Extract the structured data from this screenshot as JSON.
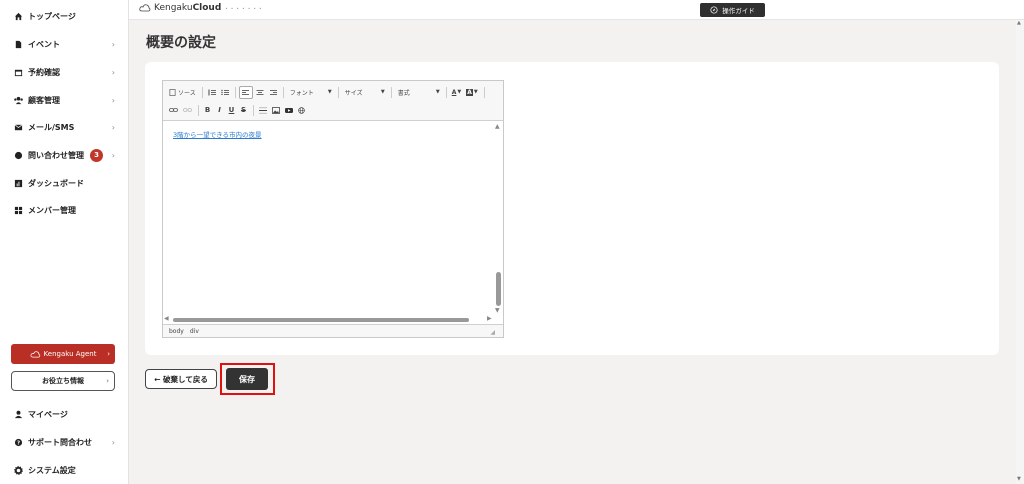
{
  "sidebar": {
    "items": [
      {
        "label": "トップページ",
        "icon": "home-icon",
        "chevron": ""
      },
      {
        "label": "イベント",
        "icon": "document-icon",
        "chevron": "›"
      },
      {
        "label": "予約確認",
        "icon": "calendar-icon",
        "chevron": "›"
      },
      {
        "label": "顧客管理",
        "icon": "users-icon",
        "chevron": "›"
      },
      {
        "label": "メール/SMS",
        "icon": "mail-icon",
        "chevron": "›"
      },
      {
        "label": "問い合わせ管理",
        "icon": "chat-icon",
        "chevron": "›",
        "badge": "3"
      },
      {
        "label": "ダッシュボード",
        "icon": "chart-icon",
        "chevron": ""
      },
      {
        "label": "メンバー管理",
        "icon": "grid-icon",
        "chevron": ""
      }
    ],
    "agent_button": "Kengaku Agent",
    "help_button": "お役立ち情報",
    "bottom_items": [
      {
        "label": "マイページ",
        "icon": "person-icon",
        "chevron": ""
      },
      {
        "label": "サポート問合わせ",
        "icon": "question-icon",
        "chevron": "›"
      },
      {
        "label": "システム設定",
        "icon": "gear-icon",
        "chevron": ""
      }
    ]
  },
  "header": {
    "logo_text": "Kengaku",
    "logo_bold": "Cloud",
    "logo_sub": "• • • • • • •",
    "guide_button": "操作ガイド"
  },
  "main": {
    "title": "概要の設定",
    "editor": {
      "toolbar": {
        "source": "ソース",
        "font": "フォント",
        "size": "サイズ",
        "format": "書式",
        "bold": "B",
        "italic": "I",
        "underline": "U",
        "strike": "S",
        "font_color": "A",
        "bg_color": "A"
      },
      "content_link": "3階から一望できる市内の夜景",
      "status_path": [
        "body",
        "div"
      ]
    },
    "back_button": "← 破棄して戻る",
    "save_button": "保存"
  },
  "colors": {
    "accent_red": "#b92e25",
    "badge_red": "#c0372a",
    "highlight_red": "#e01010",
    "dark_button": "#333333",
    "link_blue": "#2a7bd0"
  }
}
